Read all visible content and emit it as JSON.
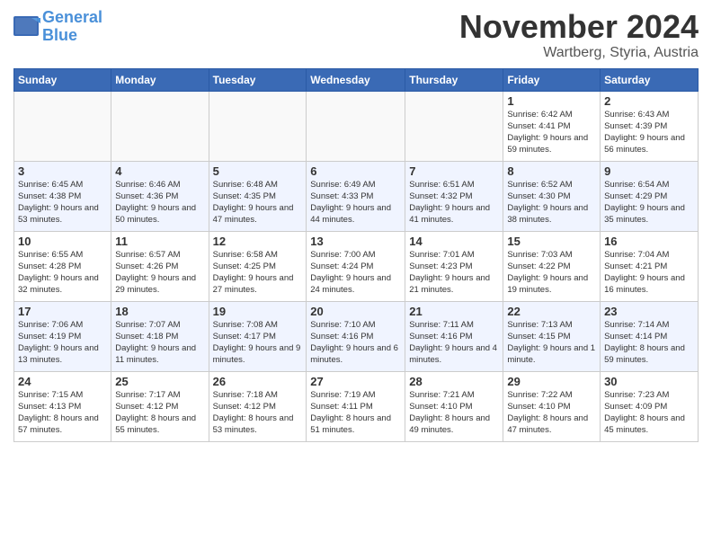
{
  "logo": {
    "line1": "General",
    "line2": "Blue"
  },
  "title": "November 2024",
  "location": "Wartberg, Styria, Austria",
  "days_of_week": [
    "Sunday",
    "Monday",
    "Tuesday",
    "Wednesday",
    "Thursday",
    "Friday",
    "Saturday"
  ],
  "weeks": [
    [
      {
        "day": "",
        "info": ""
      },
      {
        "day": "",
        "info": ""
      },
      {
        "day": "",
        "info": ""
      },
      {
        "day": "",
        "info": ""
      },
      {
        "day": "",
        "info": ""
      },
      {
        "day": "1",
        "info": "Sunrise: 6:42 AM\nSunset: 4:41 PM\nDaylight: 9 hours and 59 minutes."
      },
      {
        "day": "2",
        "info": "Sunrise: 6:43 AM\nSunset: 4:39 PM\nDaylight: 9 hours and 56 minutes."
      }
    ],
    [
      {
        "day": "3",
        "info": "Sunrise: 6:45 AM\nSunset: 4:38 PM\nDaylight: 9 hours and 53 minutes."
      },
      {
        "day": "4",
        "info": "Sunrise: 6:46 AM\nSunset: 4:36 PM\nDaylight: 9 hours and 50 minutes."
      },
      {
        "day": "5",
        "info": "Sunrise: 6:48 AM\nSunset: 4:35 PM\nDaylight: 9 hours and 47 minutes."
      },
      {
        "day": "6",
        "info": "Sunrise: 6:49 AM\nSunset: 4:33 PM\nDaylight: 9 hours and 44 minutes."
      },
      {
        "day": "7",
        "info": "Sunrise: 6:51 AM\nSunset: 4:32 PM\nDaylight: 9 hours and 41 minutes."
      },
      {
        "day": "8",
        "info": "Sunrise: 6:52 AM\nSunset: 4:30 PM\nDaylight: 9 hours and 38 minutes."
      },
      {
        "day": "9",
        "info": "Sunrise: 6:54 AM\nSunset: 4:29 PM\nDaylight: 9 hours and 35 minutes."
      }
    ],
    [
      {
        "day": "10",
        "info": "Sunrise: 6:55 AM\nSunset: 4:28 PM\nDaylight: 9 hours and 32 minutes."
      },
      {
        "day": "11",
        "info": "Sunrise: 6:57 AM\nSunset: 4:26 PM\nDaylight: 9 hours and 29 minutes."
      },
      {
        "day": "12",
        "info": "Sunrise: 6:58 AM\nSunset: 4:25 PM\nDaylight: 9 hours and 27 minutes."
      },
      {
        "day": "13",
        "info": "Sunrise: 7:00 AM\nSunset: 4:24 PM\nDaylight: 9 hours and 24 minutes."
      },
      {
        "day": "14",
        "info": "Sunrise: 7:01 AM\nSunset: 4:23 PM\nDaylight: 9 hours and 21 minutes."
      },
      {
        "day": "15",
        "info": "Sunrise: 7:03 AM\nSunset: 4:22 PM\nDaylight: 9 hours and 19 minutes."
      },
      {
        "day": "16",
        "info": "Sunrise: 7:04 AM\nSunset: 4:21 PM\nDaylight: 9 hours and 16 minutes."
      }
    ],
    [
      {
        "day": "17",
        "info": "Sunrise: 7:06 AM\nSunset: 4:19 PM\nDaylight: 9 hours and 13 minutes."
      },
      {
        "day": "18",
        "info": "Sunrise: 7:07 AM\nSunset: 4:18 PM\nDaylight: 9 hours and 11 minutes."
      },
      {
        "day": "19",
        "info": "Sunrise: 7:08 AM\nSunset: 4:17 PM\nDaylight: 9 hours and 9 minutes."
      },
      {
        "day": "20",
        "info": "Sunrise: 7:10 AM\nSunset: 4:16 PM\nDaylight: 9 hours and 6 minutes."
      },
      {
        "day": "21",
        "info": "Sunrise: 7:11 AM\nSunset: 4:16 PM\nDaylight: 9 hours and 4 minutes."
      },
      {
        "day": "22",
        "info": "Sunrise: 7:13 AM\nSunset: 4:15 PM\nDaylight: 9 hours and 1 minute."
      },
      {
        "day": "23",
        "info": "Sunrise: 7:14 AM\nSunset: 4:14 PM\nDaylight: 8 hours and 59 minutes."
      }
    ],
    [
      {
        "day": "24",
        "info": "Sunrise: 7:15 AM\nSunset: 4:13 PM\nDaylight: 8 hours and 57 minutes."
      },
      {
        "day": "25",
        "info": "Sunrise: 7:17 AM\nSunset: 4:12 PM\nDaylight: 8 hours and 55 minutes."
      },
      {
        "day": "26",
        "info": "Sunrise: 7:18 AM\nSunset: 4:12 PM\nDaylight: 8 hours and 53 minutes."
      },
      {
        "day": "27",
        "info": "Sunrise: 7:19 AM\nSunset: 4:11 PM\nDaylight: 8 hours and 51 minutes."
      },
      {
        "day": "28",
        "info": "Sunrise: 7:21 AM\nSunset: 4:10 PM\nDaylight: 8 hours and 49 minutes."
      },
      {
        "day": "29",
        "info": "Sunrise: 7:22 AM\nSunset: 4:10 PM\nDaylight: 8 hours and 47 minutes."
      },
      {
        "day": "30",
        "info": "Sunrise: 7:23 AM\nSunset: 4:09 PM\nDaylight: 8 hours and 45 minutes."
      }
    ]
  ]
}
